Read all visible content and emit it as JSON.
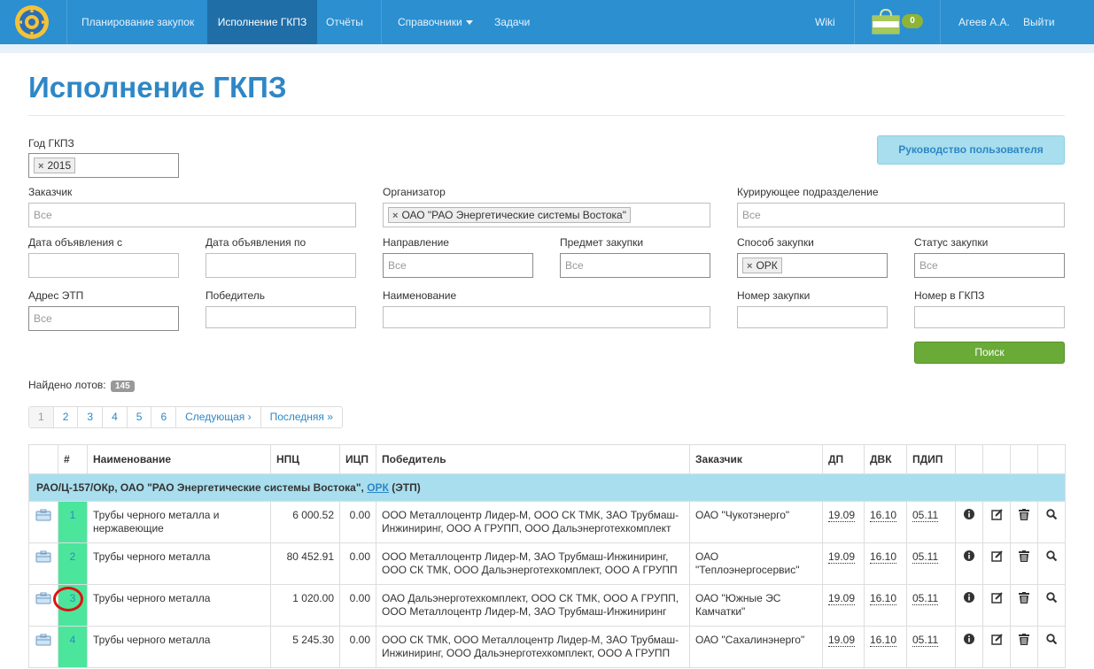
{
  "nav": {
    "items": [
      "Планирование закупок",
      "Исполнение ГКПЗ",
      "Отчёты",
      "Справочники",
      "Задачи"
    ],
    "wiki": "Wiki",
    "cart_count": "0",
    "user": "Агеев А.А.",
    "logout": "Выйти"
  },
  "page": {
    "title": "Исполнение ГКПЗ",
    "guide_button": "Руководство пользователя"
  },
  "filters": {
    "year": {
      "label": "Год ГКПЗ",
      "value": "2015"
    },
    "customer": {
      "label": "Заказчик",
      "placeholder": "Все"
    },
    "organizer": {
      "label": "Организатор",
      "value": "ОАО \"РАО Энергетические системы Востока\""
    },
    "curator": {
      "label": "Курирующее подразделение",
      "placeholder": "Все"
    },
    "date_from": {
      "label": "Дата объявления с"
    },
    "date_to": {
      "label": "Дата объявления по"
    },
    "direction": {
      "label": "Направление",
      "placeholder": "Все"
    },
    "subject": {
      "label": "Предмет закупки",
      "placeholder": "Все"
    },
    "method": {
      "label": "Способ закупки",
      "value": "ОРК"
    },
    "status": {
      "label": "Статус закупки",
      "placeholder": "Все"
    },
    "etp": {
      "label": "Адрес ЭТП",
      "placeholder": "Все"
    },
    "winner": {
      "label": "Победитель"
    },
    "name": {
      "label": "Наименование"
    },
    "number": {
      "label": "Номер закупки"
    },
    "gkpz_number": {
      "label": "Номер в ГКПЗ"
    },
    "search_button": "Поиск"
  },
  "results": {
    "found_label": "Найдено лотов:",
    "found_count": "145",
    "pages": [
      "1",
      "2",
      "3",
      "4",
      "5",
      "6",
      "Следующая ›",
      "Последняя »"
    ]
  },
  "table": {
    "headers": [
      "",
      "#",
      "Наименование",
      "НПЦ",
      "ИЦП",
      "Победитель",
      "Заказчик",
      "ДП",
      "ДВК",
      "ПДИП",
      "",
      "",
      "",
      ""
    ],
    "group": {
      "code": "РАО/Ц-157/ОКр, ОАО \"РАО Энергетические системы Востока\",",
      "method": "ОРК",
      "etp": "(ЭТП)"
    },
    "rows": [
      {
        "idx": "1",
        "name": "Трубы черного металла и нержавеющие",
        "npc": "6 000.52",
        "icp": "0.00",
        "winner": "ООО Металлоцентр Лидер-М, ООО СК ТМК, ЗАО Трубмаш-Инжиниринг, ООО А ГРУПП, ООО Дальэнерготехкомплект",
        "customer": "ОАО \"Чукотэнерго\"",
        "dp": "19.09",
        "dvk": "16.10",
        "pdip": "05.11"
      },
      {
        "idx": "2",
        "name": "Трубы черного металла",
        "npc": "80 452.91",
        "icp": "0.00",
        "winner": "ООО Металлоцентр Лидер-М, ЗАО Трубмаш-Инжиниринг, ООО СК ТМК, ООО Дальэнерготехкомплект, ООО А ГРУПП",
        "customer": "ОАО \"Теплоэнергосервис\"",
        "dp": "19.09",
        "dvk": "16.10",
        "pdip": "05.11"
      },
      {
        "idx": "3",
        "name": "Трубы черного металла",
        "npc": "1 020.00",
        "icp": "0.00",
        "winner": "ОАО Дальэнерготехкомплект, ООО СК ТМК, ООО А ГРУПП, ООО Металлоцентр Лидер-М, ЗАО Трубмаш-Инжиниринг",
        "customer": "ОАО \"Южные ЭС Камчатки\"",
        "dp": "19.09",
        "dvk": "16.10",
        "pdip": "05.11"
      },
      {
        "idx": "4",
        "name": "Трубы черного металла",
        "npc": "5 245.30",
        "icp": "0.00",
        "winner": "ООО СК ТМК, ООО Металлоцентр Лидер-М, ЗАО Трубмаш-Инжиниринг, ООО Дальэнерготехкомплект, ООО А ГРУПП",
        "customer": "ОАО \"Сахалинэнерго\"",
        "dp": "19.09",
        "dvk": "16.10",
        "pdip": "05.11"
      }
    ]
  }
}
